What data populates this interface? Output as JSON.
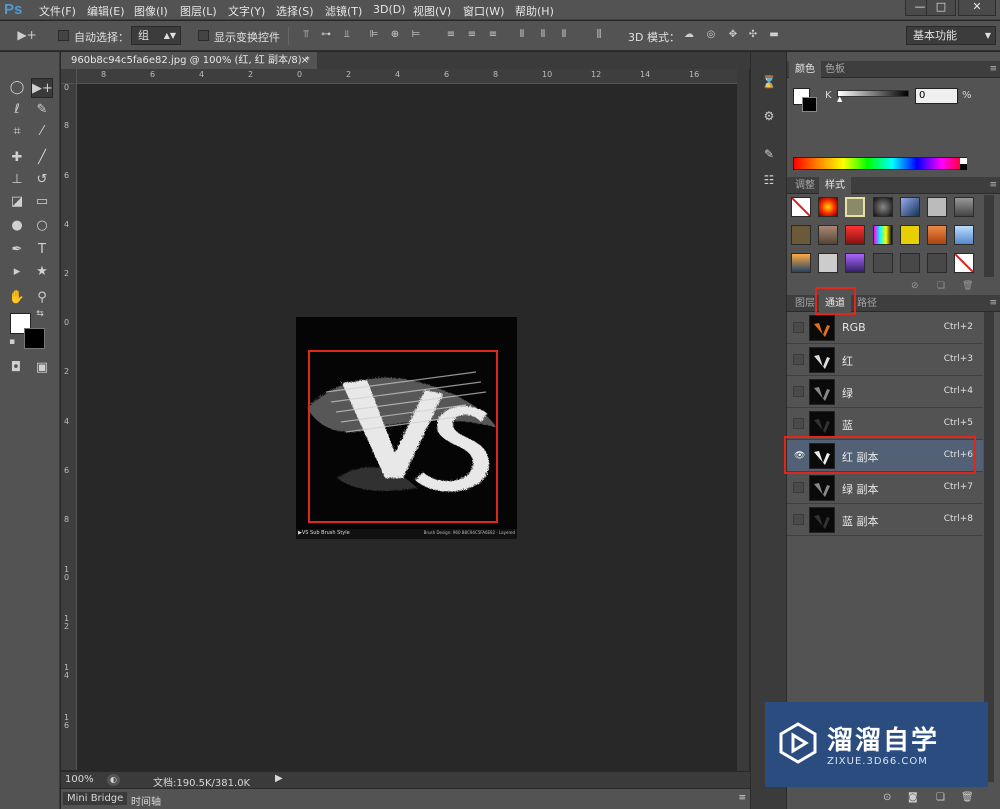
{
  "app": {
    "logo": "Ps"
  },
  "menu": [
    "文件(F)",
    "编辑(E)",
    "图像(I)",
    "图层(L)",
    "文字(Y)",
    "选择(S)",
    "滤镜(T)",
    "3D(D)",
    "视图(V)",
    "窗口(W)",
    "帮助(H)"
  ],
  "window_controls": {
    "minimize": "—",
    "restore": "□",
    "close": "✕"
  },
  "options": {
    "auto_select_label": "自动选择：",
    "auto_select_value": "组",
    "show_transform_label": "显示变换控件",
    "mode_3d_label": "3D 模式：",
    "workspace_value": "基本功能"
  },
  "document": {
    "tab_title": "960b8c94c5fa6e82.jpg @ 100% (红, 红 副本/8) *",
    "close": "×",
    "zoom": "100%",
    "doc_info": "文档:190.5K/381.0K",
    "image_caption_left": "▶VS Sub Brush Style",
    "image_caption_right": "Brush Design: 960 B8C94C5FA6E82 · Layered"
  },
  "rulers": {
    "h": [
      "8",
      "6",
      "4",
      "2",
      "0",
      "2",
      "4",
      "6",
      "8",
      "10",
      "12",
      "14",
      "16"
    ],
    "v": [
      "0",
      "8",
      "6",
      "4",
      "2",
      "0",
      "2",
      "4",
      "6",
      "8",
      "1\n0",
      "1\n2",
      "1\n4",
      "1\n6"
    ]
  },
  "bottom_tabs": [
    "Mini Bridge",
    "时间轴"
  ],
  "color_panel": {
    "tabs": [
      "颜色",
      "色板"
    ],
    "channel_label": "K",
    "value": "0",
    "unit": "%",
    "k_fraction": 0
  },
  "styles_panel": {
    "tabs": [
      "调整",
      "样式"
    ]
  },
  "channels_panel": {
    "tabs": [
      "图层",
      "通道",
      "路径"
    ],
    "channels": [
      {
        "name": "RGB",
        "shortcut": "Ctrl+2"
      },
      {
        "name": "红",
        "shortcut": "Ctrl+3"
      },
      {
        "name": "绿",
        "shortcut": "Ctrl+4"
      },
      {
        "name": "蓝",
        "shortcut": "Ctrl+5"
      },
      {
        "name": "红 副本",
        "shortcut": "Ctrl+6"
      },
      {
        "name": "绿 副本",
        "shortcut": "Ctrl+7"
      },
      {
        "name": "蓝 副本",
        "shortcut": "Ctrl+8"
      }
    ]
  },
  "watermark": {
    "title": "溜溜自学",
    "subtitle": "ZIXUE.3D66.COM"
  },
  "colors": {
    "highlight": "#e0271b",
    "selected_row": "#526175",
    "ps_blue": "#4f9ad6"
  }
}
